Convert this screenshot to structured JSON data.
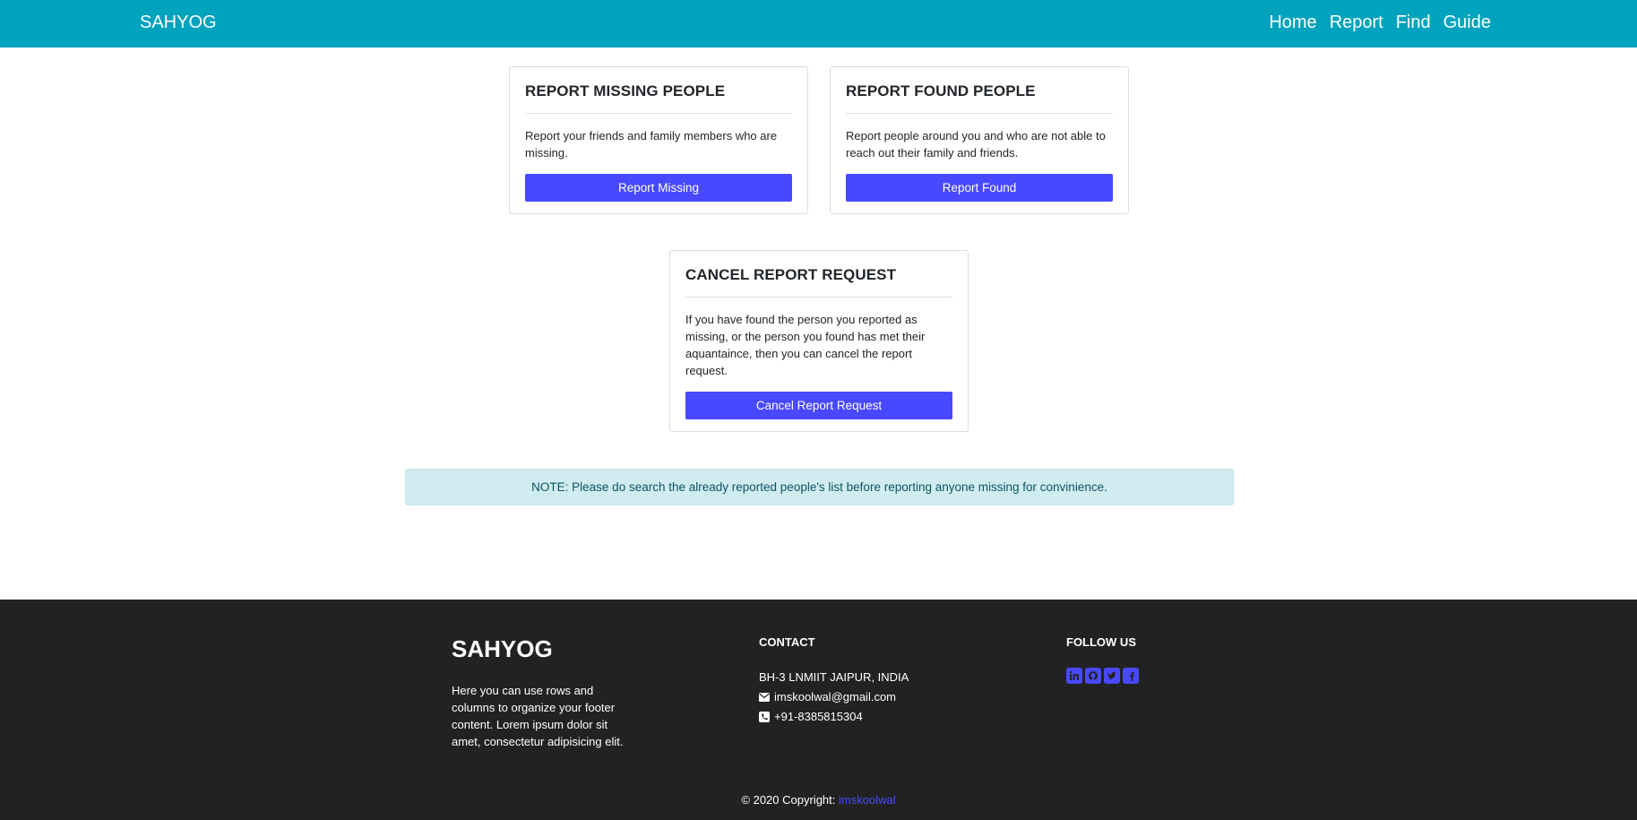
{
  "navbar": {
    "brand": "SAHYOG",
    "links": [
      "Home",
      "Report",
      "Find",
      "Guide"
    ],
    "background": "#00a3bd"
  },
  "cards": [
    {
      "title": "REPORT MISSING PEOPLE",
      "text": "Report your friends and family members who are missing.",
      "button": "Report Missing"
    },
    {
      "title": "REPORT FOUND PEOPLE",
      "text": "Report people around you and who are not able to reach out their family and friends.",
      "button": "Report Found"
    },
    {
      "title": "CANCEL REPORT REQUEST",
      "text": "If you have found the person you reported as missing, or the person you found has met their aquantaince, then you can cancel the report request.",
      "button": "Cancel Report Request"
    }
  ],
  "note": "NOTE: Please do search the already reported people's list before reporting anyone missing for convinience.",
  "footer": {
    "brand": "SAHYOG",
    "description": "Here you can use rows and columns to organize your footer content. Lorem ipsum dolor sit amet, consectetur adipisicing elit.",
    "contact_heading": "CONTACT",
    "address": "BH-3 LNMIIT JAIPUR, INDIA",
    "email": "imskoolwal@gmail.com",
    "phone": "+91-8385815304",
    "follow_heading": "FOLLOW US",
    "social_icons": [
      "linkedin-icon",
      "github-icon",
      "twitter-icon",
      "facebook-icon"
    ],
    "copyright_prefix": "© 2020 Copyright:",
    "copyright_link": "imskoolwal"
  },
  "colors": {
    "accent": "#4848ff",
    "footer_bg": "#222222",
    "note_bg": "#d1ecf1",
    "note_text": "#0c5460"
  }
}
